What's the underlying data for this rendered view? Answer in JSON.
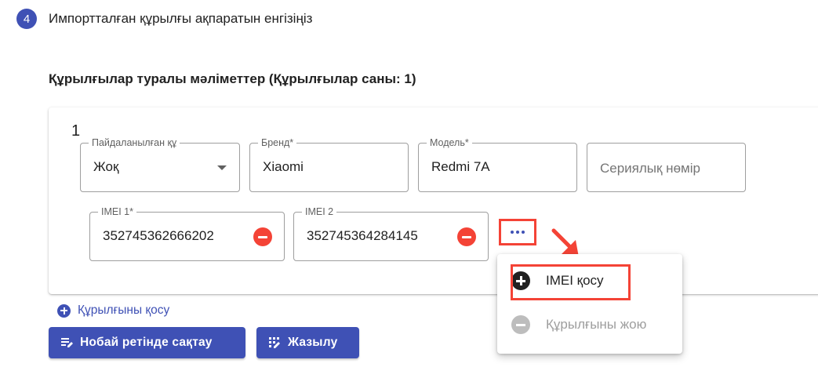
{
  "step": {
    "number": "4",
    "title": "Импортталған құрылғы ақпаратын енгізіңіз"
  },
  "section": {
    "title": "Құрылғылар туралы мәліметтер (Құрылғылар саны: 1)"
  },
  "device": {
    "index": "1",
    "used": {
      "label": "Пайдаланылған құ",
      "value": "Жоқ"
    },
    "brand": {
      "label": "Бренд*",
      "value": "Xiaomi"
    },
    "model": {
      "label": "Модель*",
      "value": "Redmi 7A"
    },
    "serial": {
      "placeholder": "Сериялық нөмір"
    },
    "imei1": {
      "label": "IMEI 1*",
      "value": "352745362666202"
    },
    "imei2": {
      "label": "IMEI 2",
      "value": "352745364284145"
    }
  },
  "actions": {
    "add_device": "Құрылғыны қосу",
    "save_template": "Нобай ретінде сақтау",
    "submit": "Жазылу"
  },
  "menu": {
    "add_imei": "IMEI қосу",
    "remove_device": "Құрылғыны жою"
  },
  "colors": {
    "primary": "#3f51b5",
    "danger": "#f44336",
    "highlight": "#f44336"
  }
}
